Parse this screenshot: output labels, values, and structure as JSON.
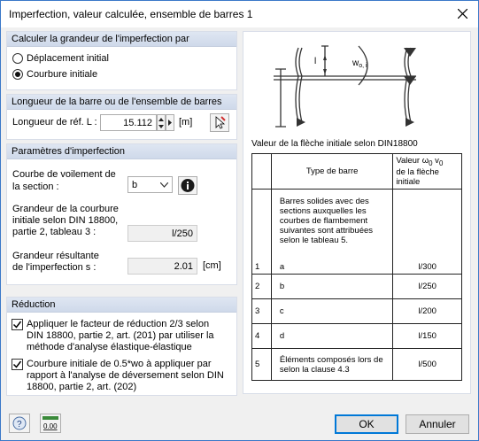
{
  "window": {
    "title": "Imperfection, valeur calculée, ensemble de barres 1"
  },
  "group_calc": {
    "header": "Calculer la grandeur de l'imperfection par",
    "options": [
      "Déplacement initial",
      "Courbure initiale"
    ],
    "selected": 1
  },
  "group_length": {
    "header": "Longueur de la barre ou de l'ensemble de barres",
    "label": "Longueur de réf. L :",
    "value": "15.112",
    "unit": "[m]"
  },
  "group_params": {
    "header": "Paramètres d'imperfection",
    "curve_label_1": "Courbe de voilement de",
    "curve_label_2": "la section :",
    "curve_value": "b",
    "curv_label_1": "Grandeur de la courbure",
    "curv_label_2": "initiale selon DIN 18800,",
    "curv_label_3": "partie 2, tableau 3 :",
    "curv_value": "l/250",
    "res_label_1": "Grandeur résultante",
    "res_label_2": "de l'imperfection s :",
    "res_value": "2.01",
    "res_unit": "[cm]"
  },
  "group_red": {
    "header": "Réduction",
    "check1_l1": "Appliquer le facteur de réduction 2/3 selon",
    "check1_l2": "DIN 18800, partie 2, art. (201) par utiliser la",
    "check1_l3": "méthode d'analyse élastique-élastique",
    "check2_l1": "Courbure initiale de 0.5*wo à appliquer par",
    "check2_l2": "rapport à l'analyse de déversement selon DIN",
    "check2_l3": "18800, partie 2, art. (202)",
    "check1": true,
    "check2": true
  },
  "figure": {
    "label_w": "w",
    "label_w_sub": "o, i",
    "label_l": "l"
  },
  "table": {
    "caption": "Valeur de la flèche initiale selon DIN18800",
    "head_type": "Type de barre",
    "head_val_1": "Valeur ω",
    "head_val_1_sub": "0",
    "head_val_1_mid": " v",
    "head_val_1_sub2": "0",
    "head_val_2": "de la flèche",
    "head_val_3": "initiale",
    "intro": "Barres solides avec des sections auxquelles les courbes de flambement suivantes sont attribuées selon le tableau 5.",
    "rows": [
      {
        "n": "1",
        "type": "a",
        "val": "l/300"
      },
      {
        "n": "2",
        "type": "b",
        "val": "l/250"
      },
      {
        "n": "3",
        "type": "c",
        "val": "l/200"
      },
      {
        "n": "4",
        "type": "d",
        "val": "l/150"
      },
      {
        "n": "5",
        "type": "Éléments composés lors de selon la clause 4.3",
        "val": "l/500"
      }
    ]
  },
  "footer": {
    "ok": "OK",
    "cancel": "Annuler",
    "units_icon_text": "0.00"
  }
}
